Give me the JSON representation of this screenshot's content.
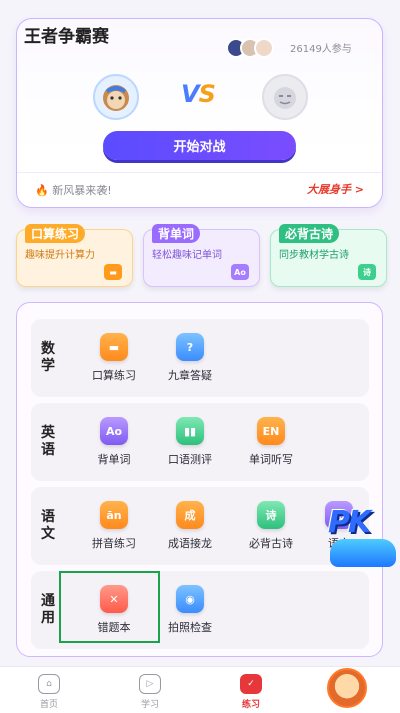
{
  "pk": {
    "title": "王者争霸赛",
    "participants": "26149人参与",
    "vs_v": "V",
    "vs_s": "S",
    "start_button": "开始对战",
    "ticker": "新风暴来袭!",
    "ticker_link": "大展身手 >"
  },
  "features": [
    {
      "title": "口算练习",
      "subtitle": "趣味提升计算力",
      "icon": "calc-icon"
    },
    {
      "title": "背单词",
      "subtitle": "轻松趣味记单词",
      "icon": "book-ao-icon"
    },
    {
      "title": "必背古诗",
      "subtitle": "同步教材学古诗",
      "icon": "poem-icon"
    }
  ],
  "subjects": [
    {
      "name": "数学",
      "tools": [
        "口算练习",
        "九章答疑"
      ]
    },
    {
      "name": "英语",
      "tools": [
        "背单词",
        "口语测评",
        "单词听写"
      ]
    },
    {
      "name": "语文",
      "tools": [
        "拼音练习",
        "成语接龙",
        "必背古诗",
        "语文"
      ]
    },
    {
      "name": "通用",
      "tools": [
        "错题本",
        "拍照检查"
      ]
    }
  ],
  "pk_badge": "PK",
  "tabs": [
    {
      "label": "首页"
    },
    {
      "label": "学习"
    },
    {
      "label": "练习"
    }
  ],
  "colors": {
    "accent": "#5b4cff",
    "active_tab": "#e8373a",
    "selected_outline": "#1aa34a"
  }
}
